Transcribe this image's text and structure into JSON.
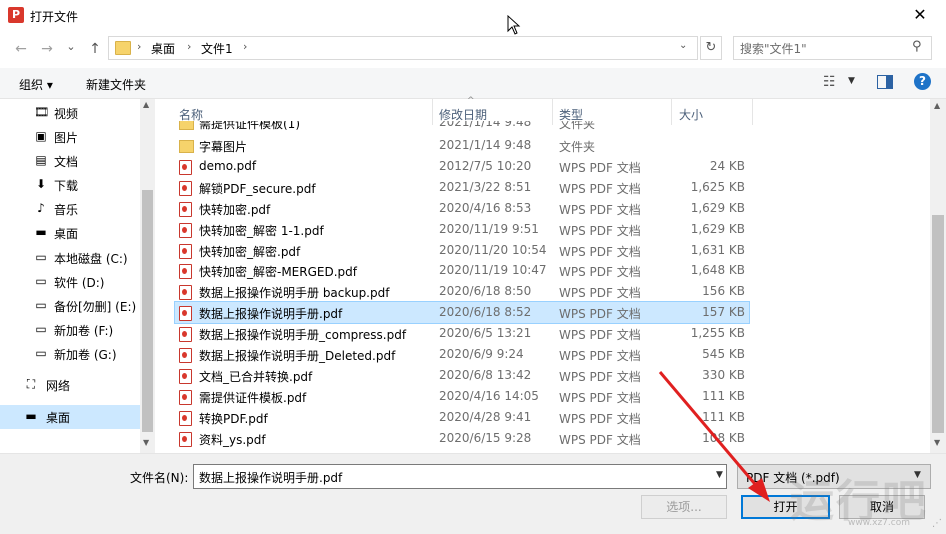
{
  "window": {
    "title": "打开文件",
    "app_icon_letter": "P",
    "close_glyph": "✕"
  },
  "nav": {
    "back_glyph": "←",
    "forward_glyph": "→",
    "dropdown_glyph": "⌄",
    "up_glyph": "↑",
    "breadcrumb": [
      "桌面",
      "文件1"
    ],
    "separator": "›",
    "search_placeholder": "搜索\"文件1\""
  },
  "toolbar": {
    "organize_label": "组织 ▾",
    "newfolder_label": "新建文件夹"
  },
  "sidebar": {
    "items": [
      {
        "label": "视频",
        "icon": "🎞"
      },
      {
        "label": "图片",
        "icon": "▣"
      },
      {
        "label": "文档",
        "icon": "▤"
      },
      {
        "label": "下载",
        "icon": "⬇"
      },
      {
        "label": "音乐",
        "icon": "♪"
      },
      {
        "label": "桌面",
        "icon": "▬"
      },
      {
        "label": "本地磁盘 (C:)",
        "icon": "▭"
      },
      {
        "label": "软件 (D:)",
        "icon": "▭"
      },
      {
        "label": "备份[勿删] (E:)",
        "icon": "▭"
      },
      {
        "label": "新加卷 (F:)",
        "icon": "▭"
      },
      {
        "label": "新加卷 (G:)",
        "icon": "▭"
      },
      {
        "label": "网络",
        "icon": "⛶"
      },
      {
        "label": "桌面",
        "icon": "▬"
      }
    ]
  },
  "columns": {
    "name": "名称",
    "date": "修改日期",
    "type": "类型",
    "size": "大小"
  },
  "partial_row": {
    "name": "需提供证件模板(1)",
    "date": "2021/1/14 9:48",
    "type": "文件夹"
  },
  "files": [
    {
      "name": "字幕图片",
      "date": "2021/1/14 9:48",
      "type": "文件夹",
      "size": "",
      "kind": "folder"
    },
    {
      "name": "demo.pdf",
      "date": "2012/7/5 10:20",
      "type": "WPS PDF 文档",
      "size": "24 KB",
      "kind": "pdf"
    },
    {
      "name": "解锁PDF_secure.pdf",
      "date": "2021/3/22 8:51",
      "type": "WPS PDF 文档",
      "size": "1,625 KB",
      "kind": "pdf"
    },
    {
      "name": "快转加密.pdf",
      "date": "2020/4/16 8:53",
      "type": "WPS PDF 文档",
      "size": "1,629 KB",
      "kind": "pdf"
    },
    {
      "name": "快转加密_解密 1-1.pdf",
      "date": "2020/11/19 9:51",
      "type": "WPS PDF 文档",
      "size": "1,629 KB",
      "kind": "pdf"
    },
    {
      "name": "快转加密_解密.pdf",
      "date": "2020/11/20 10:54",
      "type": "WPS PDF 文档",
      "size": "1,631 KB",
      "kind": "pdf"
    },
    {
      "name": "快转加密_解密-MERGED.pdf",
      "date": "2020/11/19 10:47",
      "type": "WPS PDF 文档",
      "size": "1,648 KB",
      "kind": "pdf"
    },
    {
      "name": "数据上报操作说明手册 backup.pdf",
      "date": "2020/6/18 8:50",
      "type": "WPS PDF 文档",
      "size": "156 KB",
      "kind": "pdf"
    },
    {
      "name": "数据上报操作说明手册.pdf",
      "date": "2020/6/18 8:52",
      "type": "WPS PDF 文档",
      "size": "157 KB",
      "kind": "pdf",
      "selected": true
    },
    {
      "name": "数据上报操作说明手册_compress.pdf",
      "date": "2020/6/5 13:21",
      "type": "WPS PDF 文档",
      "size": "1,255 KB",
      "kind": "pdf"
    },
    {
      "name": "数据上报操作说明手册_Deleted.pdf",
      "date": "2020/6/9 9:24",
      "type": "WPS PDF 文档",
      "size": "545 KB",
      "kind": "pdf"
    },
    {
      "name": "文档_已合并转换.pdf",
      "date": "2020/6/8 13:42",
      "type": "WPS PDF 文档",
      "size": "330 KB",
      "kind": "pdf"
    },
    {
      "name": "需提供证件模板.pdf",
      "date": "2020/4/16 14:05",
      "type": "WPS PDF 文档",
      "size": "111 KB",
      "kind": "pdf"
    },
    {
      "name": "转换PDF.pdf",
      "date": "2020/4/28 9:41",
      "type": "WPS PDF 文档",
      "size": "111 KB",
      "kind": "pdf"
    },
    {
      "name": "资料_ys.pdf",
      "date": "2020/6/15 9:28",
      "type": "WPS PDF 文档",
      "size": "108 KB",
      "kind": "pdf"
    }
  ],
  "bottom": {
    "filename_label": "文件名(N):",
    "filename_value": "数据上报操作说明手册.pdf",
    "filter_value": "PDF 文档 (*.pdf)",
    "options_label": "选项...",
    "open_label": "打开",
    "cancel_label": "取消"
  },
  "accent_color": "#0078d7",
  "annotation_color": "#e02020",
  "watermark": {
    "main": "运行吧",
    "sub": "www.xz7.com"
  }
}
